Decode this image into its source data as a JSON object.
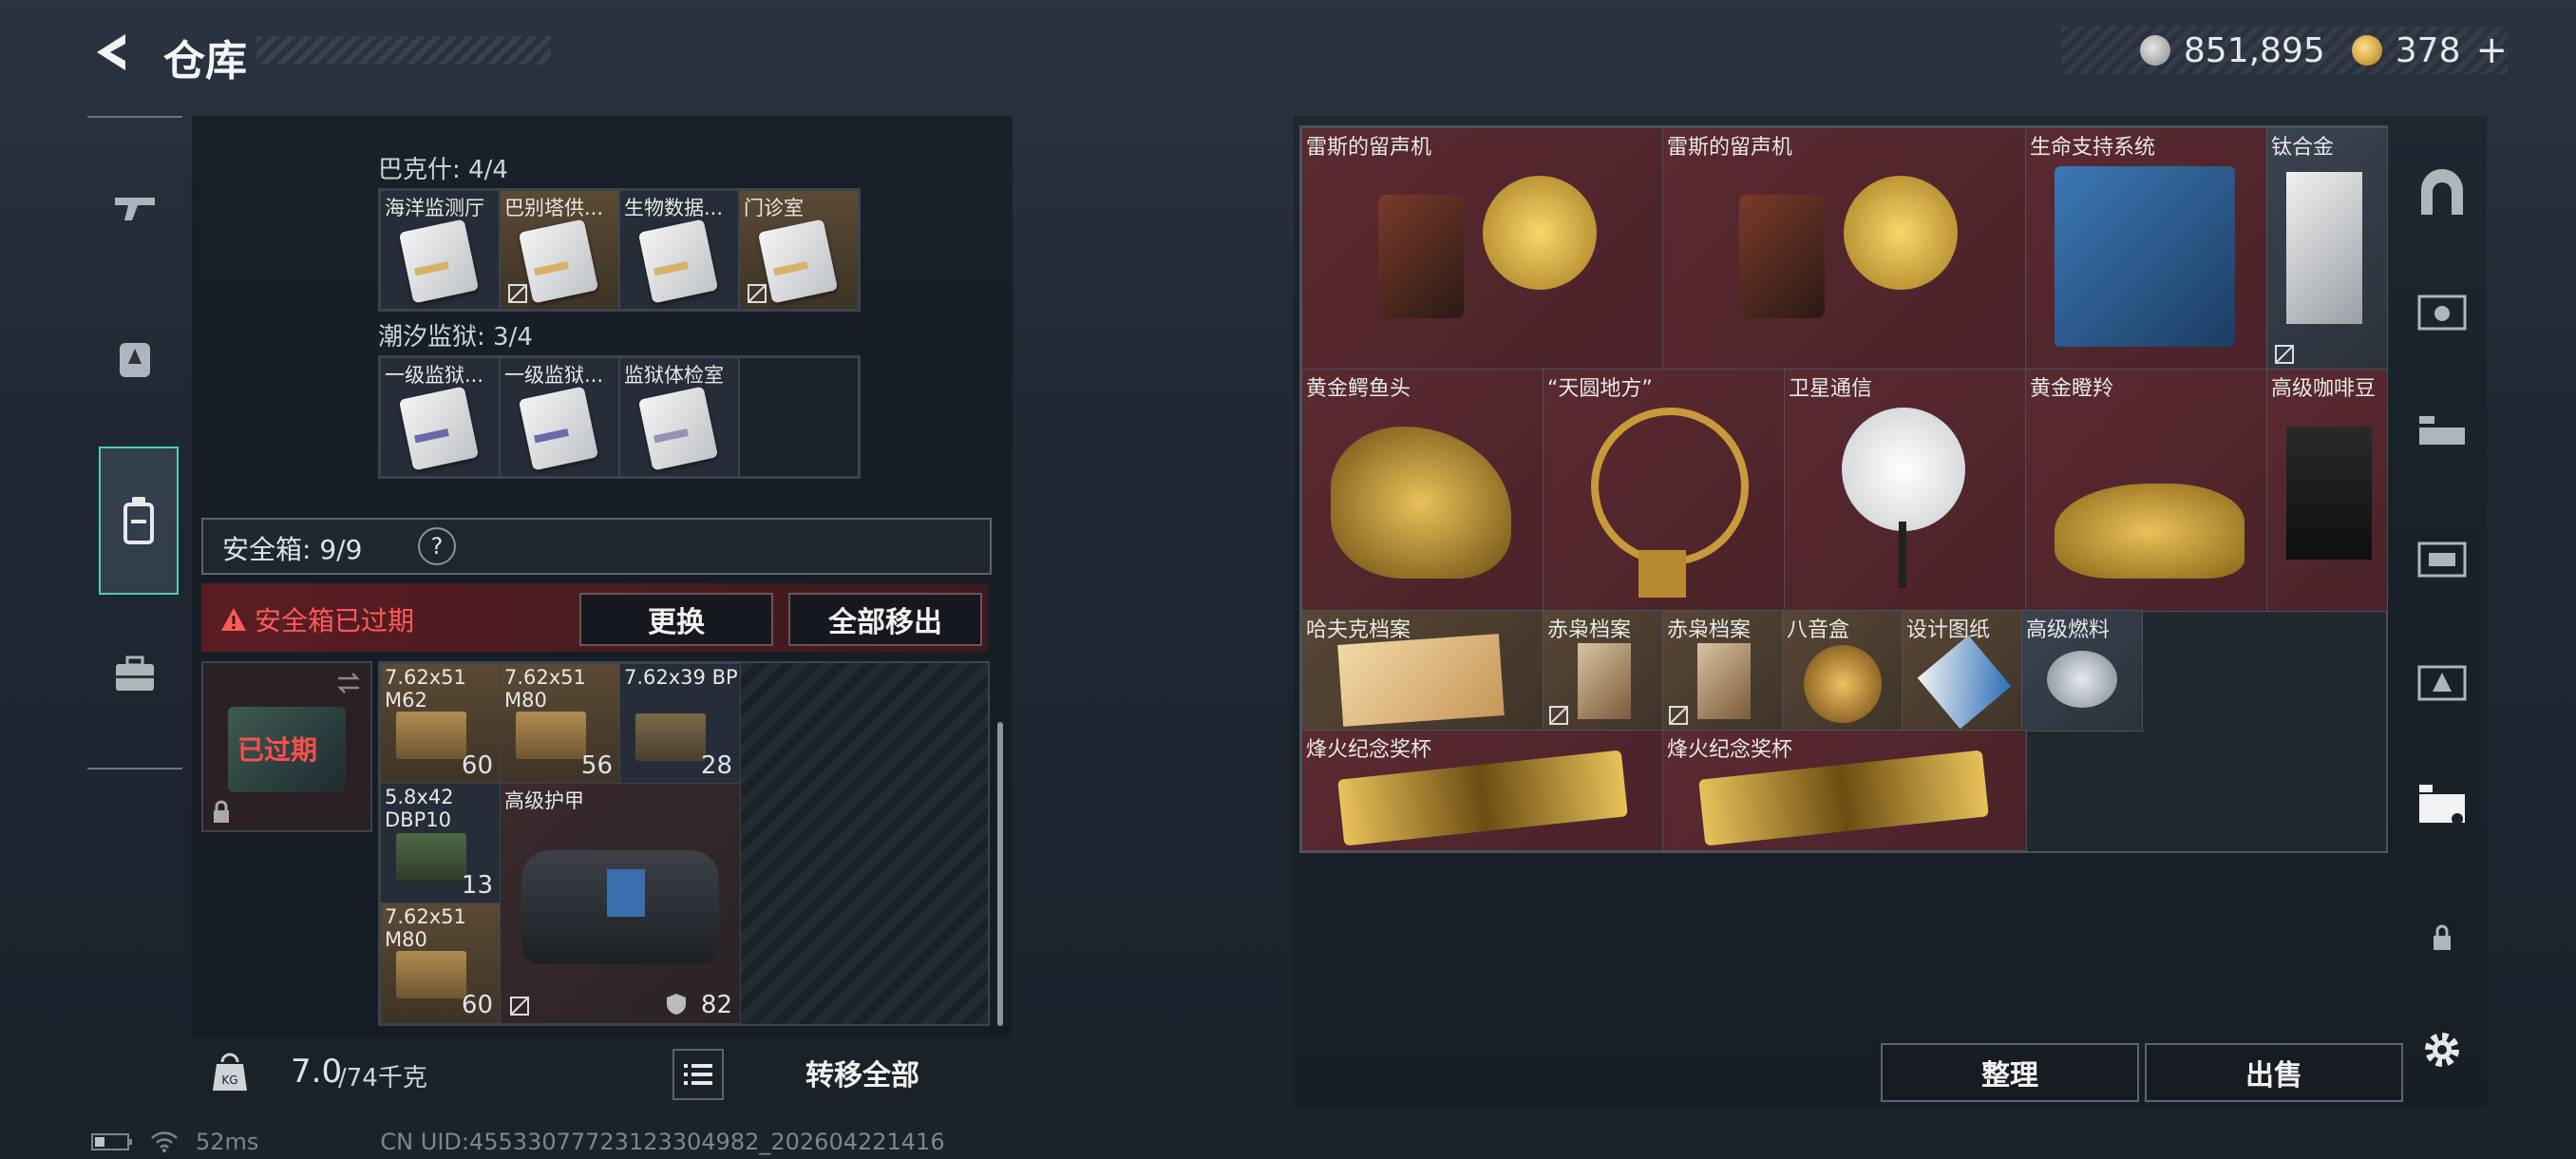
{
  "header": {
    "title": "仓库",
    "silver": "851,895",
    "gold": "378",
    "plus": "+"
  },
  "left": {
    "group1": {
      "label": "巴克什: 4/4",
      "items": [
        "海洋监测厅",
        "巴别塔供...",
        "生物数据...",
        "门诊室"
      ]
    },
    "group2": {
      "label": "潮汐监狱: 3/4",
      "items": [
        "一级监狱...",
        "一级监狱...",
        "监狱体检室"
      ]
    },
    "safe": {
      "label": "安全箱: 9/9",
      "help": "?",
      "expired": "安全箱已过期",
      "replace": "更换",
      "remove_all": "全部移出",
      "case_status": "已过期"
    },
    "ammo": [
      {
        "name": "7.62x51 M62",
        "qty": "60"
      },
      {
        "name": "7.62x51 M80",
        "qty": "56"
      },
      {
        "name": "7.62x39 BP",
        "qty": "28"
      },
      {
        "name": "5.8x42 DBP10",
        "qty": "13"
      },
      {
        "name": "7.62x51 M80",
        "qty": "60"
      }
    ],
    "armor": {
      "name": "高级护甲",
      "durability": "82"
    },
    "weight": {
      "value": "7.0",
      "max": "/74千克"
    },
    "transfer_all": "转移全部"
  },
  "right": {
    "items": [
      {
        "name": "雷斯的留声机"
      },
      {
        "name": "雷斯的留声机"
      },
      {
        "name": "生命支持系统"
      },
      {
        "name": "钛合金"
      },
      {
        "name": "黄金鳄鱼头"
      },
      {
        "name": "“天圆地方”"
      },
      {
        "name": "卫星通信"
      },
      {
        "name": "黄金瞪羚"
      },
      {
        "name": "高级咖啡豆"
      },
      {
        "name": "哈夫克档案"
      },
      {
        "name": "赤枭档案"
      },
      {
        "name": "赤枭档案"
      },
      {
        "name": "八音盒"
      },
      {
        "name": "设计图纸"
      },
      {
        "name": "高级燃料"
      },
      {
        "name": "烽火纪念奖杯"
      },
      {
        "name": "烽火纪念奖杯"
      }
    ],
    "organize": "整理",
    "sell": "出售"
  },
  "status": {
    "ping": "52ms",
    "uid": "CN UID:4553307772312330498​2_202604221416"
  }
}
